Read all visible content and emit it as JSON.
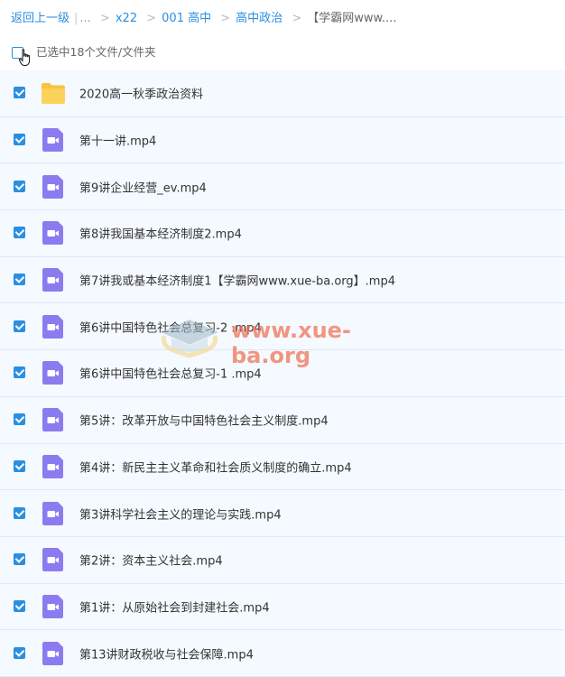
{
  "breadcrumb": {
    "back": "返回上一级",
    "ellipsis": "...",
    "sep": ">",
    "items": [
      "x22",
      "001 高中",
      "高中政治"
    ],
    "current": "【学霸网www...."
  },
  "selection": {
    "text": "已选中18个文件/文件夹"
  },
  "files": [
    {
      "name": "2020高一秋季政治资料",
      "icon": "folder-icon",
      "checked": true
    },
    {
      "name": "第十一讲.mp4",
      "icon": "video-icon",
      "checked": true
    },
    {
      "name": "第9讲企业经营_ev.mp4",
      "icon": "video-icon",
      "checked": true
    },
    {
      "name": "第8讲我国基本经济制度2.mp4",
      "icon": "video-icon",
      "checked": true
    },
    {
      "name": "第7讲我或基本经济制度1【学霸网www.xue-ba.org】.mp4",
      "icon": "video-icon",
      "checked": true
    },
    {
      "name": "第6讲中国特色社会总复习-2 .mp4",
      "icon": "video-icon",
      "checked": true
    },
    {
      "name": "第6讲中国特色社会总复习-1 .mp4",
      "icon": "video-icon",
      "checked": true
    },
    {
      "name": "第5讲：改革开放与中国特色社会主义制度.mp4",
      "icon": "video-icon",
      "checked": true
    },
    {
      "name": "第4讲：新民主主义革命和社会质义制度的确立.mp4",
      "icon": "video-icon",
      "checked": true
    },
    {
      "name": "第3讲科学社会主义的理论与实践.mp4",
      "icon": "video-icon",
      "checked": true
    },
    {
      "name": "第2讲：资本主义社会.mp4",
      "icon": "video-icon",
      "checked": true
    },
    {
      "name": "第1讲：从原始社会到封建社会.mp4",
      "icon": "video-icon",
      "checked": true
    },
    {
      "name": "第13讲财政税收与社会保障.mp4",
      "icon": "video-icon",
      "checked": true
    }
  ],
  "watermark": {
    "text": "www.xue-ba.org"
  },
  "colors": {
    "accent": "#2a8fe0",
    "video": "#8a7cf0",
    "folder": "#f7c340",
    "row_bg": "#f4faff"
  }
}
